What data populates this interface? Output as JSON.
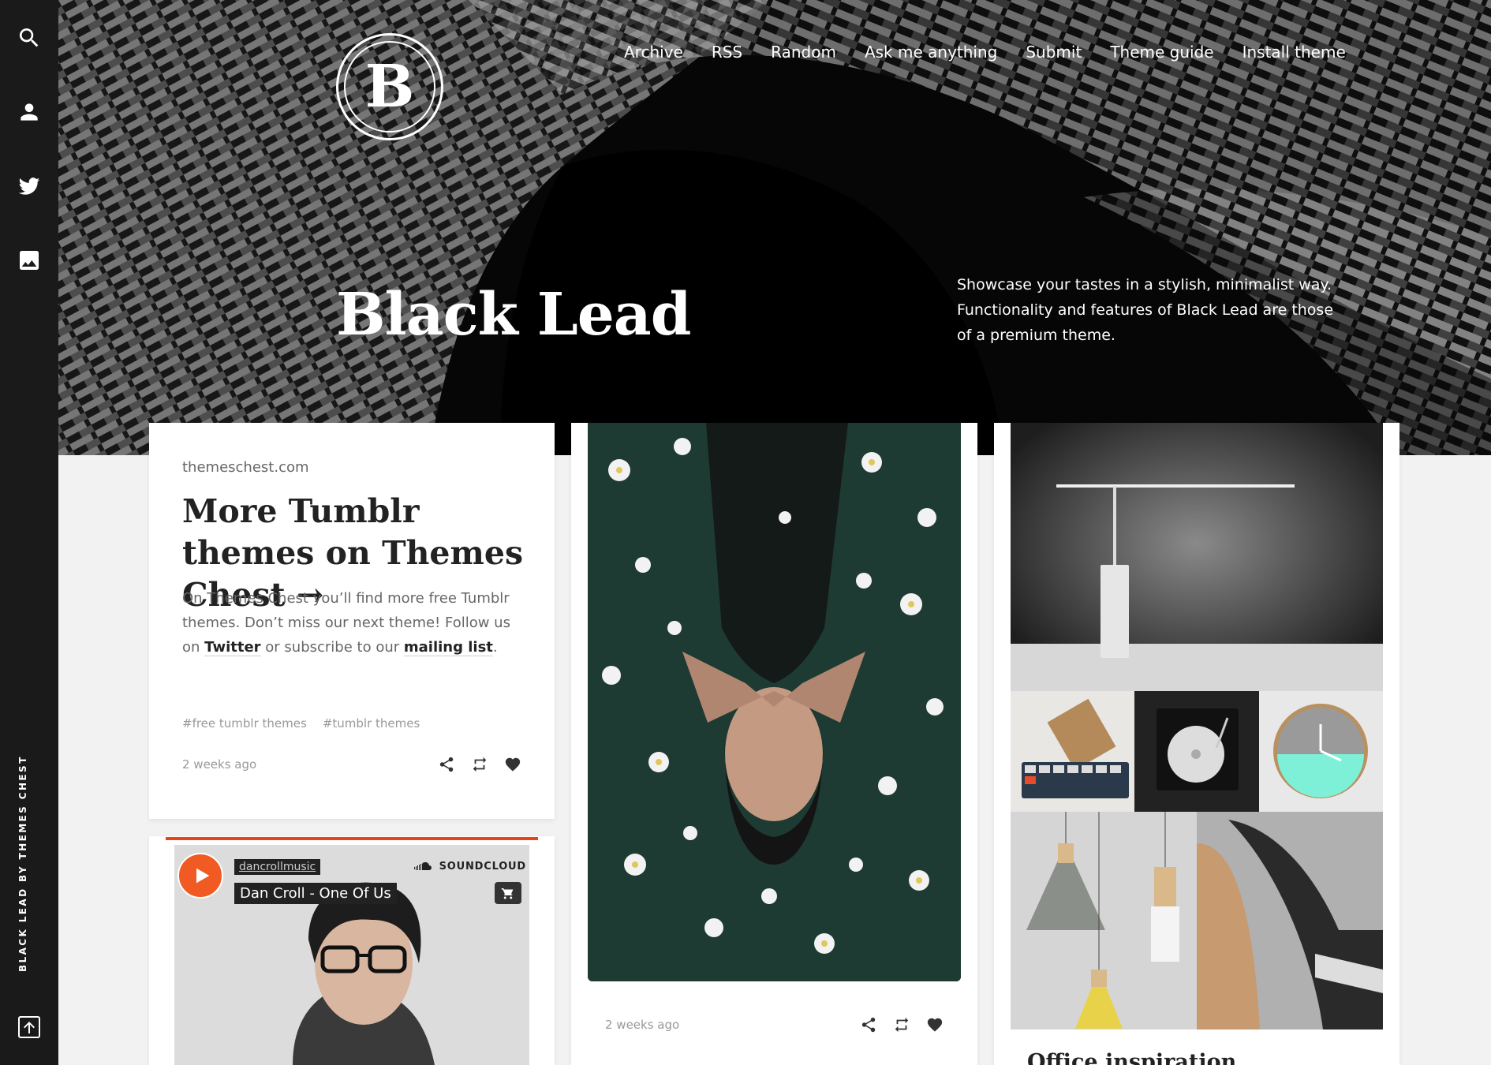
{
  "sidebar": {
    "icons": [
      "search-icon",
      "user-icon",
      "twitter-icon",
      "image-icon"
    ],
    "credit": "BLACK LEAD BY THEMES CHEST",
    "back_to_top": "arrow-up-icon"
  },
  "header": {
    "logo_letter": "B",
    "nav": [
      "Archive",
      "RSS",
      "Random",
      "Ask me anything",
      "Submit",
      "Theme guide",
      "Install theme"
    ],
    "title": "Black Lead",
    "description": "Showcase your tastes in a stylish, minimalist way. Functionality and features of Black Lead are those of a premium theme."
  },
  "posts": {
    "link_post": {
      "source": "themeschest.com",
      "title": "More Tumblr themes on Themes Chest →",
      "body_1": "On Themes Chest you’ll find more free Tumblr themes. Don’t miss our next theme! Follow us on ",
      "link_twitter": "Twitter",
      "body_2": " or subscribe to our ",
      "link_mailing": "mailing list",
      "body_3": ".",
      "tags": [
        "#free tumblr themes",
        "#tumblr themes"
      ],
      "time": "2 weeks ago"
    },
    "audio_post": {
      "user": "dancrollmusic",
      "track": "Dan Croll - One Of Us",
      "brand": "SOUNDCLOUD"
    },
    "photo_post": {
      "time": "2 weeks ago"
    },
    "photoset_post": {
      "caption": "Office inspiration"
    }
  },
  "colors": {
    "sidebar": "#1a1a1a",
    "accent_soundcloud": "#f15a22",
    "background": "#f2f2f2"
  }
}
